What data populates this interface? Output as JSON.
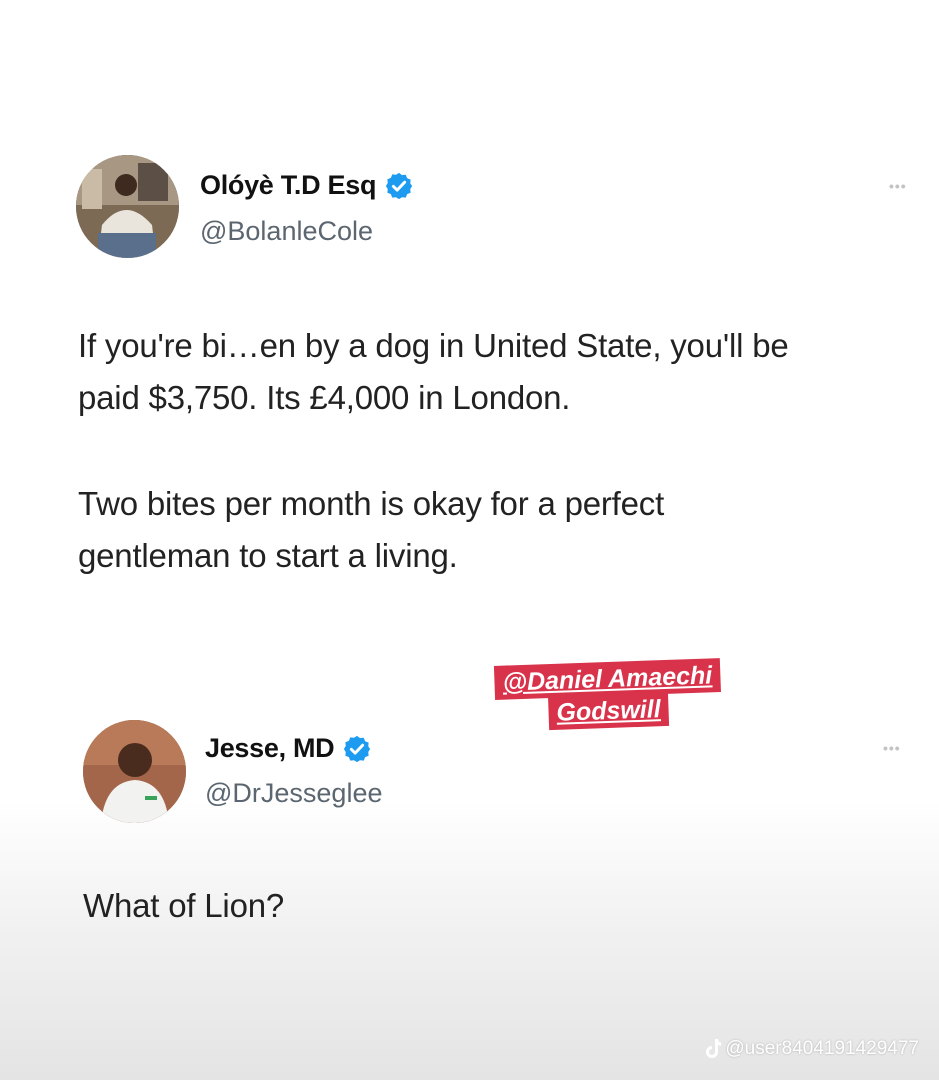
{
  "tweet1": {
    "display_name": "Olóyè T.D Esq",
    "handle": "@BolanleCole",
    "paragraph1_line1": "If you're bi…en by a dog in United State, you'll be",
    "paragraph1_line2": "paid $3,750. Its £4,000 in London.",
    "paragraph2_line1": "Two bites per month is okay for a perfect",
    "paragraph2_line2": "gentleman to start a living.",
    "more_label": "•••"
  },
  "sticker": {
    "line1": "@Daniel Amaechi",
    "line2": "Godswill"
  },
  "tweet2": {
    "display_name": "Jesse, MD",
    "handle": "@DrJesseglee",
    "text": "What of Lion?",
    "more_label": "•••"
  },
  "footer": {
    "icon": "tiktok-icon",
    "username": "@user8404191429477"
  },
  "colors": {
    "verified_blue": "#1d9bf0",
    "sticker_red": "#d8334b"
  }
}
